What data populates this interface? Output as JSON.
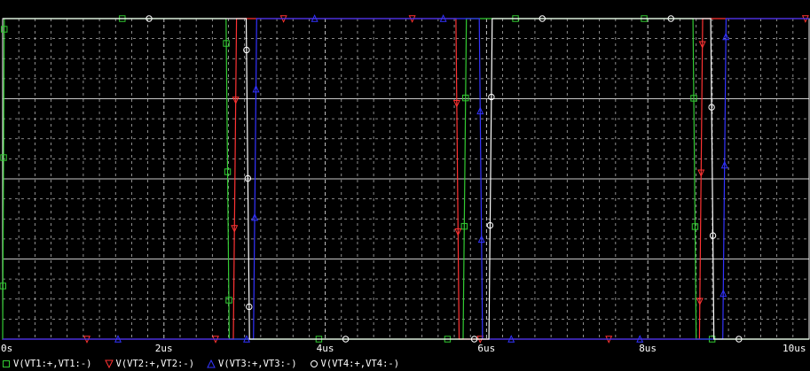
{
  "chart_data": {
    "type": "line",
    "xlabel": "",
    "ylabel": "",
    "xlim": [
      0,
      10
    ],
    "ylim": [
      0,
      1
    ],
    "grid": true,
    "legend_position": "bottom-left",
    "x_ticks": [
      {
        "value": 0,
        "label": "0s"
      },
      {
        "value": 2,
        "label": "2us"
      },
      {
        "value": 4,
        "label": "4us"
      },
      {
        "value": 6,
        "label": "6us"
      },
      {
        "value": 8,
        "label": "8us"
      },
      {
        "value": 10,
        "label": "10us"
      }
    ],
    "series": [
      {
        "name": "V(VT1:+,VT1:-)",
        "color": "#33cc33",
        "marker": "square",
        "x": [
          0,
          0.02,
          2.77,
          2.81,
          5.71,
          5.75,
          8.56,
          8.6,
          10
        ],
        "y": [
          0,
          1,
          1,
          0,
          0,
          1,
          1,
          0,
          0
        ]
      },
      {
        "name": "V(VT2:+,VT2:-)",
        "color": "#ff3333",
        "marker": "triangle-down",
        "x": [
          0,
          2.86,
          2.9,
          5.62,
          5.66,
          8.64,
          8.68,
          10
        ],
        "y": [
          0,
          0,
          1,
          1,
          0,
          0,
          1,
          1
        ]
      },
      {
        "name": "V(VT3:+,VT3:-)",
        "color": "#3333ff",
        "marker": "triangle-up",
        "x": [
          0,
          3.11,
          3.15,
          5.91,
          5.95,
          8.93,
          8.97,
          10
        ],
        "y": [
          0,
          0,
          1,
          1,
          0,
          0,
          1,
          1
        ]
      },
      {
        "name": "V(VT4:+,VT4:-)",
        "color": "#ffffff",
        "marker": "circle",
        "x": [
          0,
          3.02,
          3.06,
          6.03,
          6.07,
          8.78,
          8.82,
          10
        ],
        "y": [
          1,
          1,
          0,
          0,
          1,
          1,
          0,
          0
        ]
      }
    ]
  }
}
